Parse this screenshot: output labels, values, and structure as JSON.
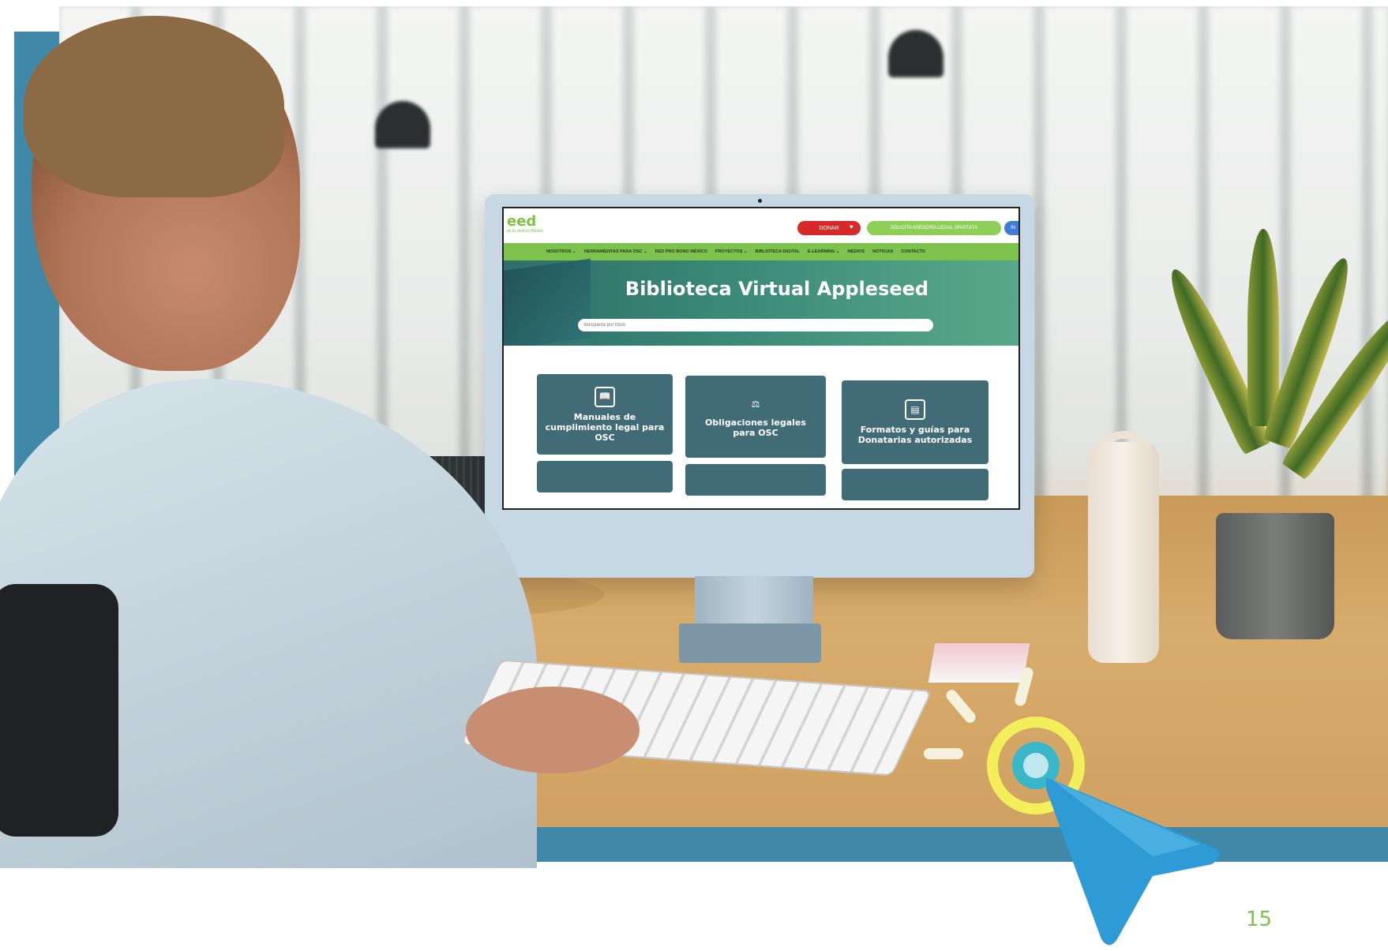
{
  "website": {
    "logo_text": "eed",
    "logo_subtext": "de la Justicia México",
    "header_buttons": {
      "donate": "DONAR",
      "legal_advice": "SOLICITA ASESORÍA LEGAL GRATUITA",
      "in": "IN"
    },
    "nav_items": [
      "NOSOTROS ⌄",
      "HERRAMIENTAS PARA OSC ⌄",
      "RED PRO BONO MÉXICO",
      "PROYECTOS ⌄",
      "BIBLIOTECA DIGITAL",
      "E-LEARNING ⌄",
      "MEDIOS",
      "NOTICIAS",
      "CONTACTO"
    ],
    "hero_title": "Biblioteca Virtual Appleseed",
    "search_placeholder": "Búsqueda por título",
    "cards": [
      {
        "label": "Manuales de cumplimiento legal para OSC",
        "icon": "book-icon"
      },
      {
        "label": "Obligaciones legales para OSC",
        "icon": "scales-icon"
      },
      {
        "label": "Formatos y guías para Donatarias autorizadas",
        "icon": "documents-icon"
      }
    ]
  },
  "page_number": "15",
  "colors": {
    "frame_blue": "#3f88a8",
    "nav_green": "#7ec24e",
    "card_teal": "#416b76",
    "donate_red": "#d62a2a",
    "cursor_blue": "#2f9bd6",
    "ring_yellow": "#f2ef5a",
    "page_number_green": "#7ec24e"
  }
}
